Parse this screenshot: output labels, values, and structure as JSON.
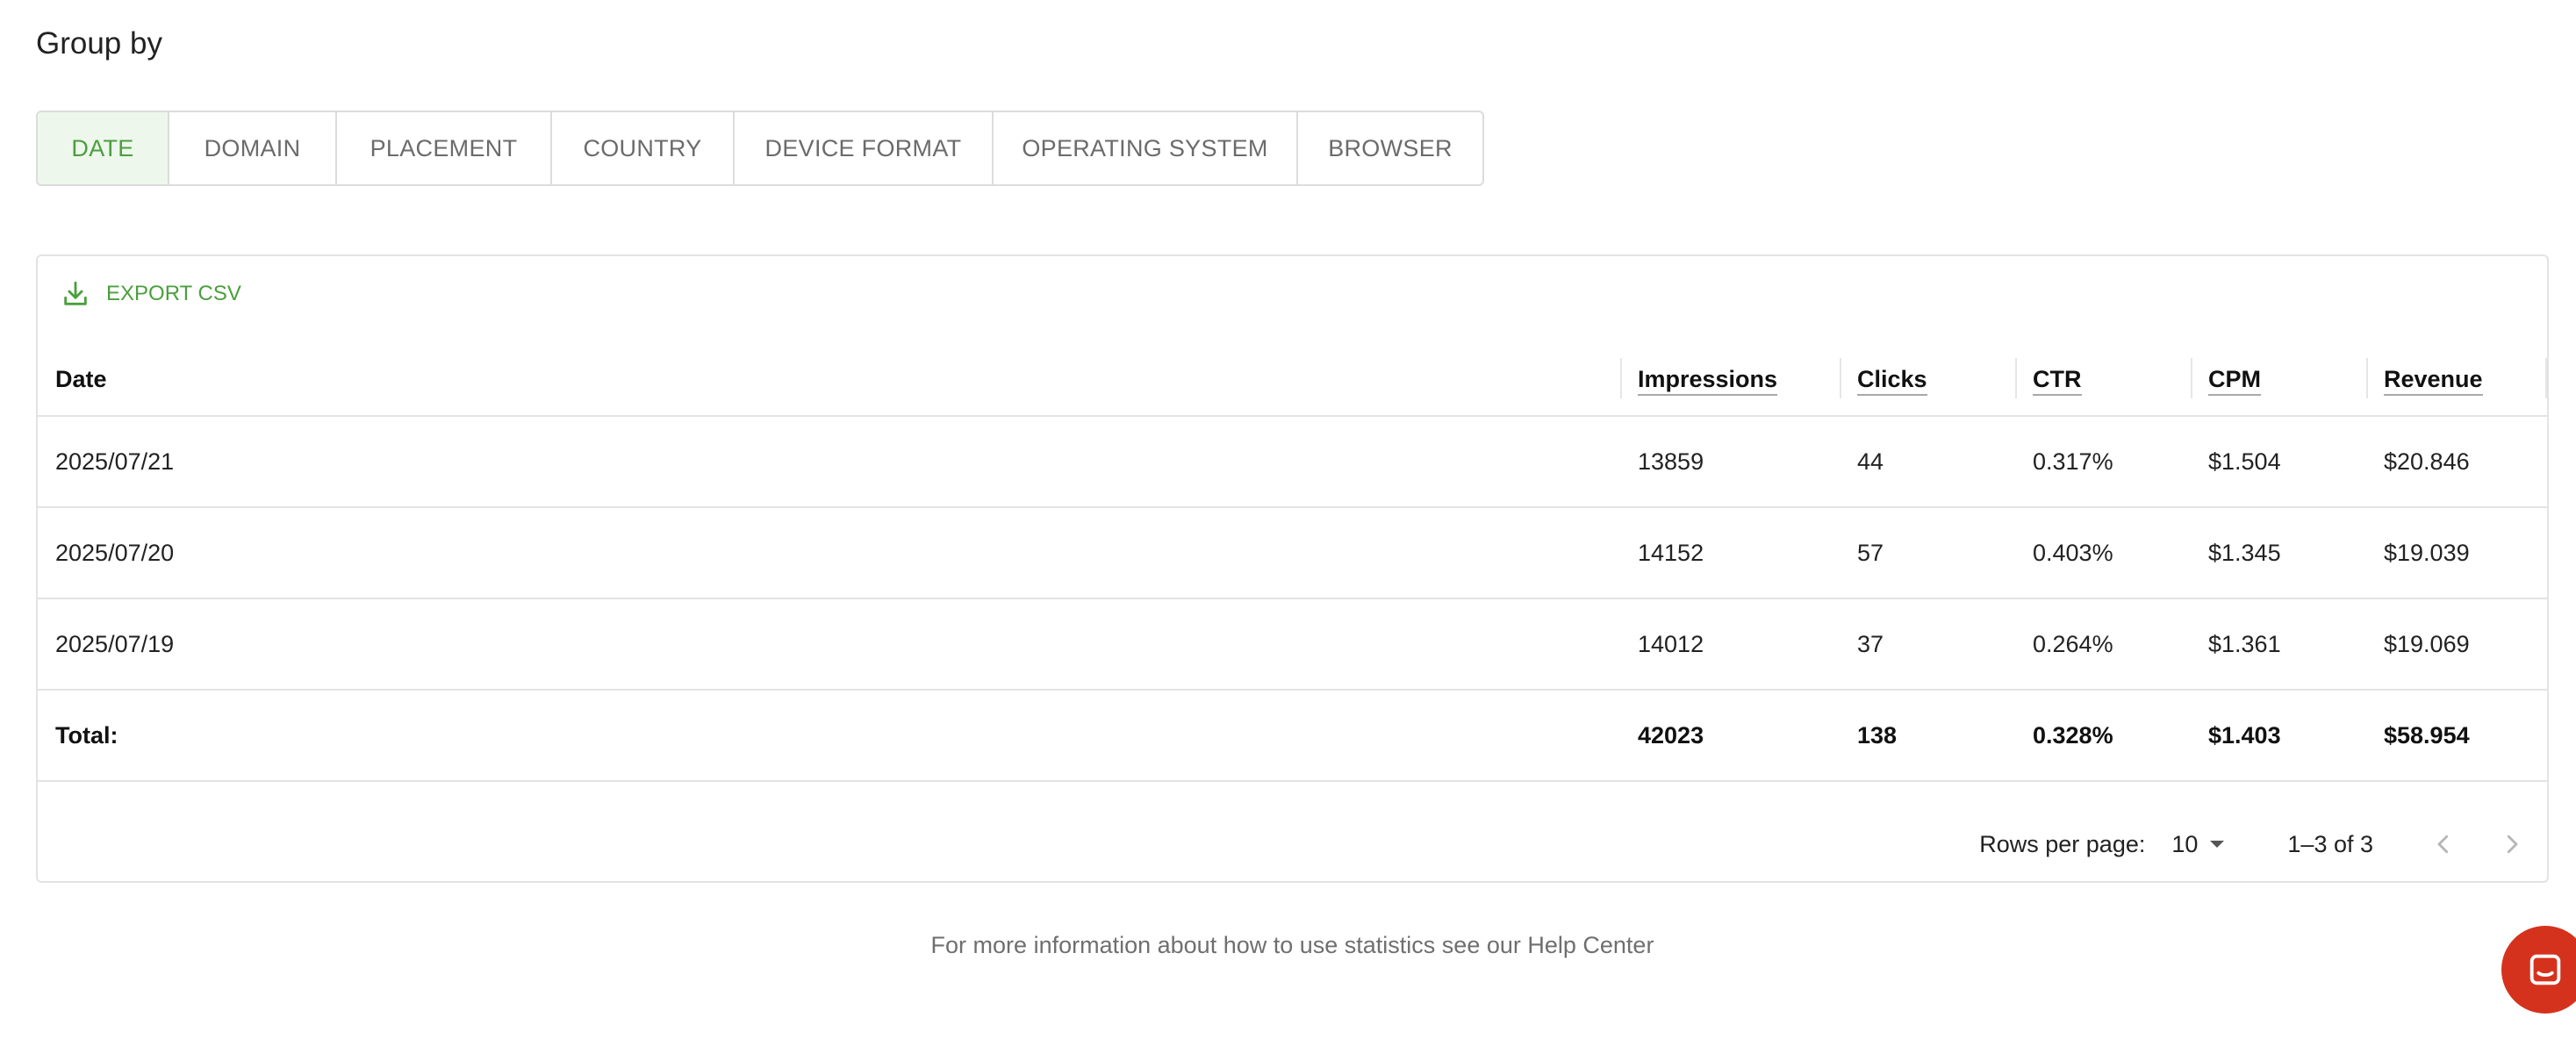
{
  "group_by": {
    "title": "Group by",
    "tabs": [
      {
        "label": "DATE",
        "active": true
      },
      {
        "label": "DOMAIN",
        "active": false
      },
      {
        "label": "PLACEMENT",
        "active": false
      },
      {
        "label": "COUNTRY",
        "active": false
      },
      {
        "label": "DEVICE FORMAT",
        "active": false
      },
      {
        "label": "OPERATING SYSTEM",
        "active": false
      },
      {
        "label": "BROWSER",
        "active": false
      }
    ]
  },
  "toolbar": {
    "export_label": "EXPORT CSV",
    "export_icon": "download-icon"
  },
  "table": {
    "headers": {
      "date": "Date",
      "impressions": "Impressions",
      "clicks": "Clicks",
      "ctr": "CTR",
      "cpm": "CPM",
      "revenue": "Revenue"
    },
    "rows": [
      {
        "date": "2025/07/21",
        "impressions": "13859",
        "clicks": "44",
        "ctr": "0.317%",
        "cpm": "$1.504",
        "revenue": "$20.846"
      },
      {
        "date": "2025/07/20",
        "impressions": "14152",
        "clicks": "57",
        "ctr": "0.403%",
        "cpm": "$1.345",
        "revenue": "$19.039"
      },
      {
        "date": "2025/07/19",
        "impressions": "14012",
        "clicks": "37",
        "ctr": "0.264%",
        "cpm": "$1.361",
        "revenue": "$19.069"
      }
    ],
    "total": {
      "label": "Total:",
      "impressions": "42023",
      "clicks": "138",
      "ctr": "0.328%",
      "cpm": "$1.403",
      "revenue": "$58.954"
    }
  },
  "pagination": {
    "rows_per_page_label": "Rows per page:",
    "rows_per_page_value": "10",
    "range": "1–3 of 3"
  },
  "footer": {
    "help_prefix": "For more information about how to use statistics see our ",
    "help_link": "Help Center"
  },
  "colors": {
    "accent": "#4a9f3c",
    "active_tab_bg": "#eef7ec",
    "chat_button": "#d5321e"
  }
}
